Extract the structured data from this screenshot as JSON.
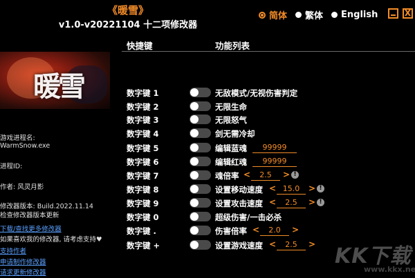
{
  "window": {
    "game_title": "《暖雪》",
    "version_title": "v1.0-v20221104 十二项修改器",
    "languages": [
      {
        "label": "简体",
        "selected": true
      },
      {
        "label": "繁体",
        "selected": false
      },
      {
        "label": "English",
        "selected": false
      }
    ],
    "close_glyph": "X"
  },
  "table": {
    "header_hotkey": "快捷键",
    "header_functions": "功能列表"
  },
  "banner": {
    "text": "暖雪"
  },
  "info": {
    "process_label": "游戏进程名:",
    "process_value": "WarmSnow.exe",
    "pid_label": "进程ID:",
    "author": "作者: 风灵月影",
    "version": "修改器版本: Build.2022.11.14",
    "check_update": "检查修改器版本更新",
    "download_more": "下载/查找更多修改器",
    "support_text": "如果喜欢我的修改器, 请考虑支持♥",
    "support_author": "支持作者",
    "request_trainer": "申请制作修改器",
    "request_update": "请求更新修改器"
  },
  "cheats": [
    {
      "hotkey": "数字键 1",
      "name": "无敌模式/无视伤害判定",
      "enabled": false
    },
    {
      "hotkey": "数字键 2",
      "name": "无限生命",
      "enabled": false
    },
    {
      "hotkey": "数字键 3",
      "name": "无限怒气",
      "enabled": false
    },
    {
      "hotkey": "数字键 4",
      "name": "剑无需冷却",
      "enabled": false
    },
    {
      "hotkey": "数字键 5",
      "name": "编辑蓝魂",
      "enabled": false,
      "input": "99999"
    },
    {
      "hotkey": "数字键 6",
      "name": "编辑红魂",
      "enabled": false,
      "input": "99999"
    },
    {
      "hotkey": "数字键 7",
      "name": "魂倍率",
      "enabled": false,
      "stepper": "2.5",
      "left_arrow": "<",
      "right_arrow": ">",
      "warning": "!"
    },
    {
      "hotkey": "数字键 8",
      "name": "设置移动速度",
      "enabled": false,
      "stepper": "15.0",
      "left_arrow": "<",
      "right_arrow": ">",
      "warning": "!"
    },
    {
      "hotkey": "数字键 9",
      "name": "设置攻击速度",
      "enabled": false,
      "stepper": "2.5",
      "left_arrow": "<",
      "right_arrow": ">",
      "warning": "!"
    },
    {
      "hotkey": "数字键 0",
      "name": "超级伤害/一击必杀",
      "enabled": false
    },
    {
      "hotkey": "数字键 .",
      "name": "伤害倍率",
      "enabled": false,
      "stepper": "2.0",
      "left_arrow": "<",
      "right_arrow": ">"
    },
    {
      "hotkey": "数字键 +",
      "name": "设置游戏速度",
      "enabled": false,
      "stepper": "2.5",
      "left_arrow": "<",
      "right_arrow": ">"
    }
  ],
  "watermark": {
    "text": "KK下载",
    "url": "www.kkx.net"
  },
  "colors": {
    "accent": "#f28c28",
    "background": "#000000",
    "link": "#5aa0ff",
    "toggle_off": "#4a4a4a"
  }
}
